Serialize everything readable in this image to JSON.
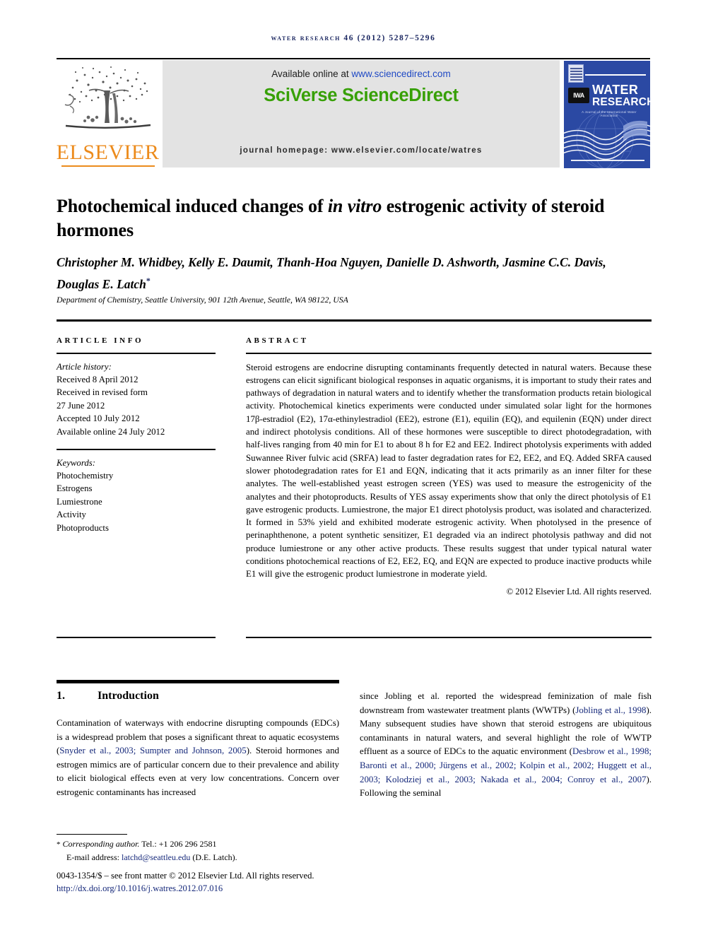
{
  "running_head": "Water Research 46 (2012) 5287–5296",
  "masthead": {
    "publisher_name": "ELSEVIER",
    "available_prefix": "Available online at ",
    "available_url": "www.sciencedirect.com",
    "platform_logo": "SciVerse ScienceDirect",
    "journal_homepage": "journal homepage: www.elsevier.com/locate/watres",
    "cover": {
      "line1": "WATER",
      "line2": "RESEARCH",
      "society_mark": "IWA",
      "subtitle": "A Journal of the International Water Association"
    },
    "colors": {
      "elsevier_orange": "#ec8b1c",
      "sciencedirect_green": "#37a006",
      "link_blue": "#1f49c4",
      "cover_blue": "#2b49a3",
      "citation_blue": "#15287a",
      "banner_grey": "#e3e3e3"
    }
  },
  "article": {
    "title_line1": "Photochemical induced changes of ",
    "title_italic": "in vitro",
    "title_line2": " estrogenic activity of steroid hormones",
    "authors": "Christopher M. Whidbey, Kelly E. Daumit, Thanh-Hoa Nguyen, Danielle D. Ashworth, Jasmine C.C. Davis, Douglas E. Latch",
    "corresponding_marker": "*",
    "affiliation": "Department of Chemistry, Seattle University, 901 12th Avenue, Seattle, WA 98122, USA"
  },
  "info": {
    "heading": "ARTICLE INFO",
    "history_label": "Article history:",
    "history": [
      "Received 8 April 2012",
      "Received in revised form",
      "27 June 2012",
      "Accepted 10 July 2012",
      "Available online 24 July 2012"
    ],
    "keywords_label": "Keywords:",
    "keywords": [
      "Photochemistry",
      "Estrogens",
      "Lumiestrone",
      "Activity",
      "Photoproducts"
    ]
  },
  "abstract": {
    "heading": "ABSTRACT",
    "text": "Steroid estrogens are endocrine disrupting contaminants frequently detected in natural waters. Because these estrogens can elicit significant biological responses in aquatic organisms, it is important to study their rates and pathways of degradation in natural waters and to identify whether the transformation products retain biological activity. Photochemical kinetics experiments were conducted under simulated solar light for the hormones 17β-estradiol (E2), 17α-ethinylestradiol (EE2), estrone (E1), equilin (EQ), and equilenin (EQN) under direct and indirect photolysis conditions. All of these hormones were susceptible to direct photodegradation, with half-lives ranging from 40 min for E1 to about 8 h for E2 and EE2. Indirect photolysis experiments with added Suwannee River fulvic acid (SRFA) lead to faster degradation rates for E2, EE2, and EQ. Added SRFA caused slower photodegradation rates for E1 and EQN, indicating that it acts primarily as an inner filter for these analytes. The well-established yeast estrogen screen (YES) was used to measure the estrogenicity of the analytes and their photoproducts. Results of YES assay experiments show that only the direct photolysis of E1 gave estrogenic products. Lumiestrone, the major E1 direct photolysis product, was isolated and characterized. It formed in 53% yield and exhibited moderate estrogenic activity. When photolysed in the presence of perinaphthenone, a potent synthetic sensitizer, E1 degraded via an indirect photolysis pathway and did not produce lumiestrone or any other active products. These results suggest that under typical natural water conditions photochemical reactions of E2, EE2, EQ, and EQN are expected to produce inactive products while E1 will give the estrogenic product lumiestrone in moderate yield.",
    "copyright": "© 2012 Elsevier Ltd. All rights reserved."
  },
  "section": {
    "number": "1.",
    "title": "Introduction",
    "left_paragraph_parts": [
      "Contamination of waterways with endocrine disrupting compounds (EDCs) is a widespread problem that poses a significant threat to aquatic ecosystems (",
      "Snyder et al., 2003; Sumpter and Johnson, 2005",
      "). Steroid hormones and estrogen mimics are of particular concern due to their prevalence and ability to elicit biological effects even at very low concentrations. Concern over estrogenic contaminants has increased"
    ],
    "right_paragraph_parts": [
      "since Jobling et al. reported the widespread feminization of male fish downstream from wastewater treatment plants (WWTPs) (",
      "Jobling et al., 1998",
      "). Many subsequent studies have shown that steroid estrogens are ubiquitous contaminants in natural waters, and several highlight the role of WWTP effluent as a source of EDCs to the aquatic environment (",
      "Desbrow et al., 1998; Baronti et al., 2000; Jürgens et al., 2002; Kolpin et al., 2002; Huggett et al., 2003; Kolodziej et al., 2003; Nakada et al., 2004; Conroy et al., 2007",
      "). Following the seminal"
    ]
  },
  "footer": {
    "corresponding_marker": "*",
    "corresponding_text": "Corresponding author.",
    "tel": "Tel.: +1 206 296 2581",
    "email_label": "E-mail address:",
    "email": "latchd@seattleu.edu",
    "email_owner": "(D.E. Latch).",
    "front_matter": "0043-1354/$ – see front matter © 2012 Elsevier Ltd. All rights reserved.",
    "doi": "http://dx.doi.org/10.1016/j.watres.2012.07.016"
  }
}
